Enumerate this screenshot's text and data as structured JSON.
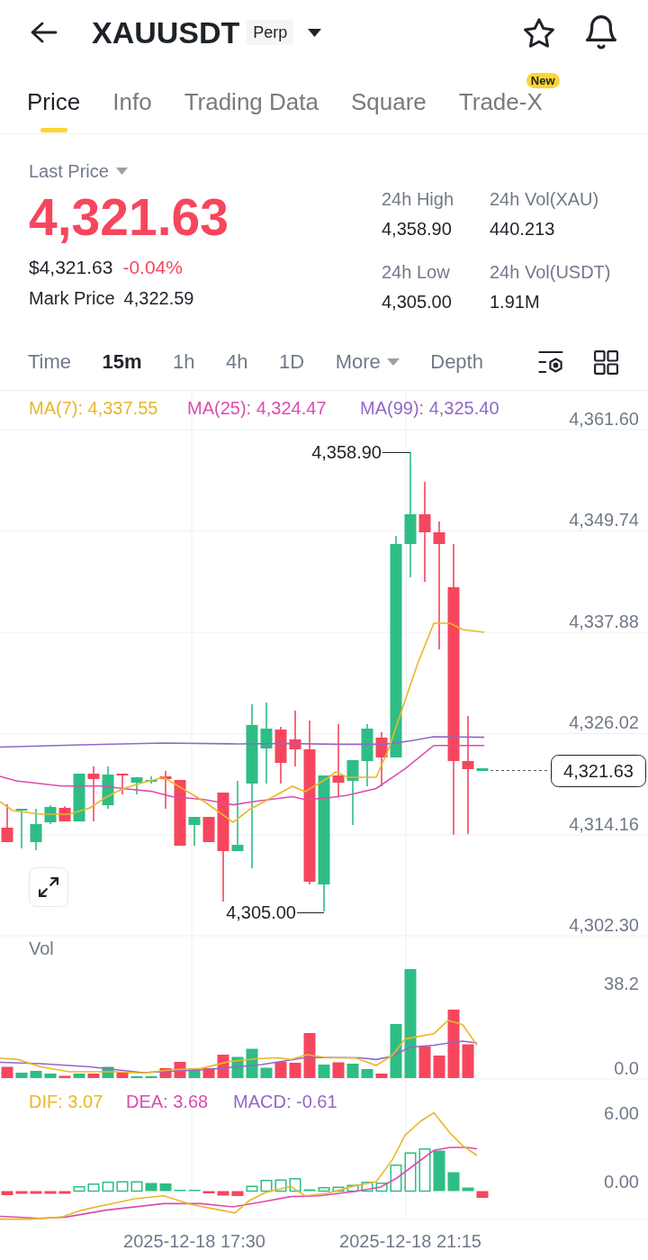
{
  "header": {
    "symbol": "XAUUSDT",
    "badge": "Perp"
  },
  "tabs": [
    {
      "label": "Price",
      "selected": true
    },
    {
      "label": "Info",
      "selected": false
    },
    {
      "label": "Trading Data",
      "selected": false
    },
    {
      "label": "Square",
      "selected": false
    },
    {
      "label": "Trade-X",
      "selected": false,
      "badge": "New"
    }
  ],
  "ticker": {
    "label": "Last Price",
    "last_price": "4,321.63",
    "rising": false,
    "usd_price": "$4,321.63",
    "change": "-0.04%",
    "mark_price_label": "Mark Price",
    "mark_price": "4,322.59"
  },
  "stats": [
    {
      "label": "24h High",
      "value": "4,358.90"
    },
    {
      "label": "24h Vol(XAU)",
      "value": "440.213"
    },
    {
      "label": "24h Low",
      "value": "4,305.00"
    },
    {
      "label": "24h Vol(USDT)",
      "value": "1.91M"
    }
  ],
  "intervals": [
    {
      "label": "Time",
      "kind": "option",
      "selected": false
    },
    {
      "label": "15m",
      "kind": "option",
      "selected": true
    },
    {
      "label": "1h",
      "kind": "option",
      "selected": false
    },
    {
      "label": "4h",
      "kind": "option",
      "selected": false
    },
    {
      "label": "1D",
      "kind": "option",
      "selected": false
    },
    {
      "label": "More",
      "kind": "dropdown",
      "selected": false
    },
    {
      "label": "Depth",
      "kind": "option",
      "selected": false
    }
  ],
  "price_chart": {
    "indicators": [
      {
        "label": "MA(7): 4,337.55",
        "color": "#e9b72a"
      },
      {
        "label": "MA(25): 4,324.47",
        "color": "#dc4cb0"
      },
      {
        "label": "MA(99): 4,325.40",
        "color": "#9068c8"
      }
    ],
    "y_ticks": [
      "4,361.60",
      "4,349.74",
      "4,337.88",
      "4,326.02",
      "4,314.16",
      "4,302.30"
    ],
    "high_marker": "4,358.90",
    "low_marker": "4,305.00",
    "current_price": "4,321.63"
  },
  "volume_chart": {
    "label": "Vol",
    "y_ticks": [
      "38.2",
      "0.0"
    ]
  },
  "macd_chart": {
    "indicators": [
      {
        "label": "DIF: 3.07",
        "color": "#e9b72a"
      },
      {
        "label": "DEA: 3.68",
        "color": "#dc4cb0"
      },
      {
        "label": "MACD: -0.61",
        "color": "#9068c8"
      }
    ],
    "y_ticks": [
      "6.00",
      "0.00"
    ]
  },
  "x_axis": {
    "labels": [
      "2025-12-18 17:30",
      "2025-12-18 21:15"
    ]
  }
}
